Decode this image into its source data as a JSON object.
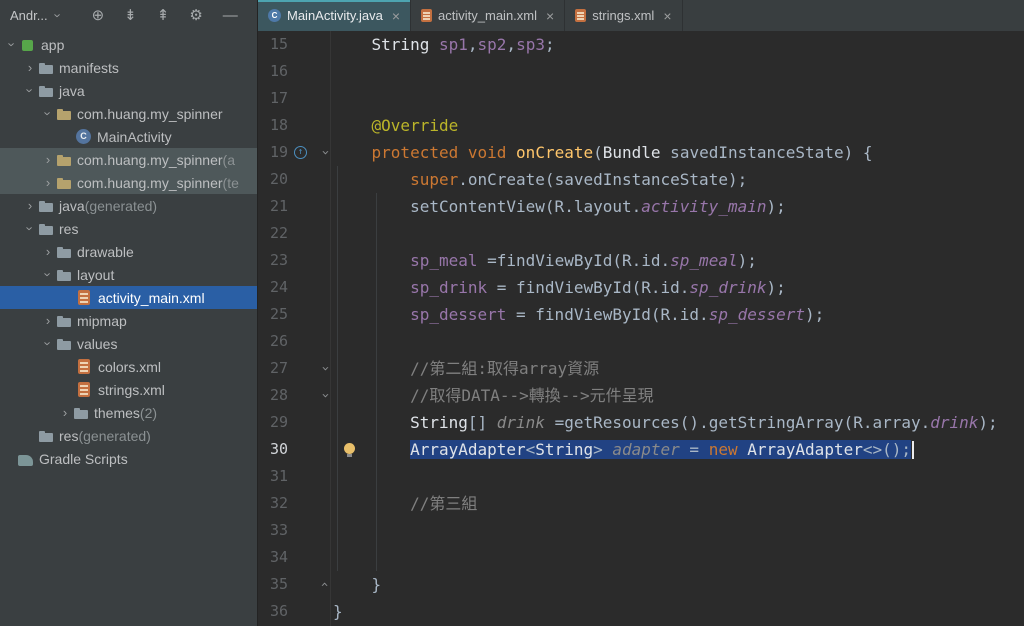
{
  "icons": {
    "close": "×",
    "chevron": "›",
    "up_arrow": "↑"
  },
  "colors": {
    "editor_bg": "#2B2B2B",
    "panel_bg": "#3A3F41",
    "tab_active_bg": "#3C575F",
    "tab_active_underline": "#4DA4B0",
    "selection": "#214283",
    "tree_selected": "#2A5FA5",
    "tree_muted_selected": "#4E585A",
    "keyword": "#CC7832",
    "annotation": "#BBB529",
    "method": "#FFC66B",
    "field": "#9876AA",
    "comment": "#808080",
    "plain_text": "#A9B7C6",
    "line_number": "#606366",
    "bulb": "#E8BF6A"
  },
  "header": {
    "selector": "Andr...",
    "icons": {
      "locate": "⊕",
      "scroll_down": "⇟",
      "scroll_up": "⇞",
      "settings": "⚙",
      "hide": "—"
    }
  },
  "tabs": [
    {
      "label": "MainActivity.java",
      "icon": "class",
      "active": true
    },
    {
      "label": "activity_main.xml",
      "icon": "xml",
      "active": false
    },
    {
      "label": "strings.xml",
      "icon": "xml",
      "active": false
    }
  ],
  "tree": [
    {
      "label": "app",
      "icon": "app",
      "chev": "down",
      "indent": 4
    },
    {
      "label": "manifests",
      "icon": "folder",
      "chev": "right",
      "indent": 22
    },
    {
      "label": "java",
      "icon": "folder",
      "chev": "down",
      "indent": 22
    },
    {
      "label": "com.huang.my_spinner",
      "icon": "package",
      "chev": "down",
      "indent": 40
    },
    {
      "label": "MainActivity",
      "icon": "class",
      "chev": "none",
      "indent": 76
    },
    {
      "label": "com.huang.my_spinner",
      "suffix": " (a",
      "icon": "package",
      "chev": "right",
      "indent": 40,
      "state": "muted"
    },
    {
      "label": "com.huang.my_spinner",
      "suffix": " (te",
      "icon": "package",
      "chev": "right",
      "indent": 40,
      "state": "muted"
    },
    {
      "label": "java",
      "suffix": " (generated)",
      "icon": "folder-gen",
      "chev": "right",
      "indent": 22
    },
    {
      "label": "res",
      "icon": "folder",
      "chev": "down",
      "indent": 22
    },
    {
      "label": "drawable",
      "icon": "folder",
      "chev": "right",
      "indent": 40
    },
    {
      "label": "layout",
      "icon": "folder",
      "chev": "down",
      "indent": 40
    },
    {
      "label": "activity_main.xml",
      "icon": "xml-layout",
      "chev": "none",
      "indent": 76,
      "state": "selected"
    },
    {
      "label": "mipmap",
      "icon": "folder",
      "chev": "right",
      "indent": 40
    },
    {
      "label": "values",
      "icon": "folder",
      "chev": "down",
      "indent": 40
    },
    {
      "label": "colors.xml",
      "icon": "xml",
      "chev": "none",
      "indent": 76
    },
    {
      "label": "strings.xml",
      "icon": "xml",
      "chev": "none",
      "indent": 76
    },
    {
      "label": "themes",
      "suffix": " (2)",
      "icon": "folder",
      "chev": "right",
      "indent": 57
    },
    {
      "label": "res",
      "suffix": " (generated)",
      "icon": "folder-gen",
      "chev": "none",
      "indent": 38
    },
    {
      "label": "Gradle Scripts",
      "icon": "gradle",
      "chev": "none",
      "indent": 18
    }
  ],
  "editor": {
    "lines": [
      {
        "n": "15",
        "t": [
          [
            "p",
            "    "
          ],
          [
            "cls",
            "String"
          ],
          [
            "p",
            " "
          ],
          [
            "f",
            "sp1"
          ],
          [
            "p",
            ","
          ],
          [
            "f",
            "sp2"
          ],
          [
            "p",
            ","
          ],
          [
            "f",
            "sp3"
          ],
          [
            "p",
            ";"
          ]
        ]
      },
      {
        "n": "16",
        "t": []
      },
      {
        "n": "17",
        "t": []
      },
      {
        "n": "18",
        "t": [
          [
            "p",
            "    "
          ],
          [
            "a",
            "@Override"
          ]
        ]
      },
      {
        "n": "19",
        "t": [
          [
            "p",
            "    "
          ],
          [
            "k",
            "protected"
          ],
          [
            "p",
            " "
          ],
          [
            "k",
            "void"
          ],
          [
            "p",
            " "
          ],
          [
            "m",
            "onCreate"
          ],
          [
            "p",
            "("
          ],
          [
            "cls",
            "Bundle"
          ],
          [
            "p",
            " savedInstanceState) {"
          ]
        ],
        "fold": "down",
        "override": true
      },
      {
        "n": "20",
        "t": [
          [
            "p",
            "        "
          ],
          [
            "k",
            "super"
          ],
          [
            "p",
            ".onCreate(savedInstanceState);"
          ]
        ]
      },
      {
        "n": "21",
        "t": [
          [
            "p",
            "        setContentView(R.layout."
          ],
          [
            "fi",
            "activity_main"
          ],
          [
            "p",
            ");"
          ]
        ]
      },
      {
        "n": "22",
        "t": []
      },
      {
        "n": "23",
        "t": [
          [
            "p",
            "        "
          ],
          [
            "f",
            "sp_meal"
          ],
          [
            "p",
            " =findViewById(R.id."
          ],
          [
            "fi",
            "sp_meal"
          ],
          [
            "p",
            ");"
          ]
        ]
      },
      {
        "n": "24",
        "t": [
          [
            "p",
            "        "
          ],
          [
            "f",
            "sp_drink"
          ],
          [
            "p",
            " = findViewById(R.id."
          ],
          [
            "fi",
            "sp_drink"
          ],
          [
            "p",
            ");"
          ]
        ]
      },
      {
        "n": "25",
        "t": [
          [
            "p",
            "        "
          ],
          [
            "f",
            "sp_dessert"
          ],
          [
            "p",
            " = findViewById(R.id."
          ],
          [
            "fi",
            "sp_dessert"
          ],
          [
            "p",
            ");"
          ]
        ]
      },
      {
        "n": "26",
        "t": []
      },
      {
        "n": "27",
        "t": [
          [
            "p",
            "        "
          ],
          [
            "c",
            "//第二組:取得array資源"
          ]
        ],
        "fold": "down"
      },
      {
        "n": "28",
        "t": [
          [
            "p",
            "        "
          ],
          [
            "c",
            "//取得DATA-->轉換-->元件呈現"
          ]
        ],
        "fold": "down"
      },
      {
        "n": "29",
        "t": [
          [
            "p",
            "        "
          ],
          [
            "cls",
            "String"
          ],
          [
            "p",
            "[] "
          ],
          [
            "g",
            "drink"
          ],
          [
            "p",
            " =getResources().getStringArray(R.array."
          ],
          [
            "fi",
            "drink"
          ],
          [
            "p",
            ");"
          ]
        ]
      },
      {
        "n": "30",
        "t": [
          [
            "p",
            "        "
          ],
          [
            "cls",
            "ArrayAdapter"
          ],
          [
            "p",
            "<"
          ],
          [
            "cls",
            "String"
          ],
          [
            "p",
            "> "
          ],
          [
            "g",
            "adapter"
          ],
          [
            "p",
            " = "
          ],
          [
            "k",
            "new"
          ],
          [
            "p",
            " "
          ],
          [
            "cls",
            "ArrayAdapter"
          ],
          [
            "p",
            "<>();"
          ]
        ],
        "selFrom": 1,
        "bulb": true,
        "current": true
      },
      {
        "n": "31",
        "t": []
      },
      {
        "n": "32",
        "t": [
          [
            "p",
            "        "
          ],
          [
            "c",
            "//第三組"
          ]
        ]
      },
      {
        "n": "33",
        "t": []
      },
      {
        "n": "34",
        "t": []
      },
      {
        "n": "35",
        "t": [
          [
            "p",
            "    }"
          ]
        ],
        "fold": "up"
      },
      {
        "n": "36",
        "t": [
          [
            "p",
            "}"
          ]
        ]
      }
    ]
  }
}
